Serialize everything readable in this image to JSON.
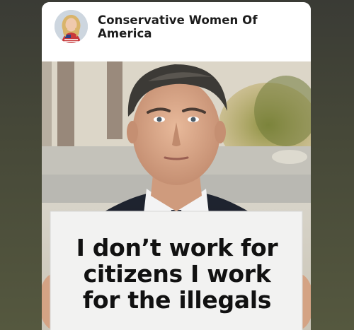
{
  "post": {
    "page_name": "Conservative Women Of America",
    "sign_lines": [
      "I don’t work for",
      "citizens I work",
      "for the illegals"
    ]
  },
  "icons": {
    "avatar": "profile-photo-avatar"
  },
  "colors": {
    "background": "#454738",
    "card": "#ffffff",
    "name_text": "#1c1c1c",
    "sign_text": "#111111"
  }
}
